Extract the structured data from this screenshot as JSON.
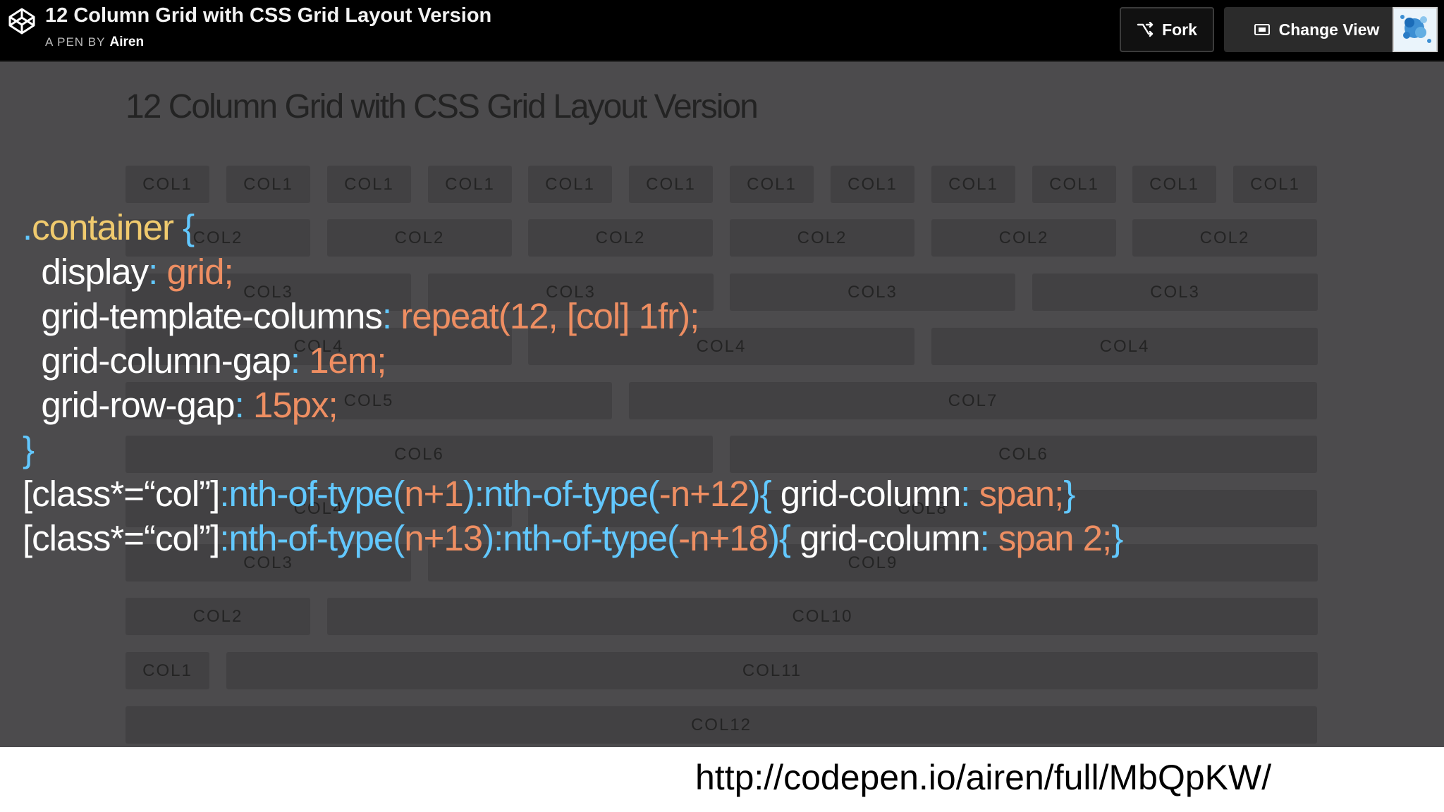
{
  "header": {
    "title": "12 Column Grid with CSS Grid Layout Version",
    "by_label": "A PEN BY",
    "author": "Airen",
    "fork_label": "Fork",
    "change_view_label": "Change View",
    "logo_icon": "codepen-logo-icon",
    "fork_icon": "fork-icon",
    "view_icon": "change-view-icon"
  },
  "main": {
    "heading": "12 Column Grid with CSS Grid Layout Version",
    "rows": [
      {
        "cells": [
          {
            "label": "COL1"
          },
          {
            "label": "COL1"
          },
          {
            "label": "COL1"
          },
          {
            "label": "COL1"
          },
          {
            "label": "COL1"
          },
          {
            "label": "COL1"
          },
          {
            "label": "COL1"
          },
          {
            "label": "COL1"
          },
          {
            "label": "COL1"
          },
          {
            "label": "COL1"
          },
          {
            "label": "COL1"
          },
          {
            "label": "COL1"
          }
        ]
      },
      {
        "cells": [
          {
            "label": "COL2"
          },
          {
            "label": "COL2"
          },
          {
            "label": "COL2"
          },
          {
            "label": "COL2"
          },
          {
            "label": "COL2"
          },
          {
            "label": "COL2"
          }
        ]
      },
      {
        "cells": [
          {
            "label": "COL3"
          },
          {
            "label": "COL3"
          },
          {
            "label": "COL3"
          },
          {
            "label": "COL3"
          }
        ]
      },
      {
        "cells": [
          {
            "label": "COL4"
          },
          {
            "label": "COL4"
          },
          {
            "label": "COL4"
          }
        ]
      },
      {
        "cells": [
          {
            "label": "COL5"
          },
          {
            "label": "COL7"
          }
        ]
      },
      {
        "cells": [
          {
            "label": "COL6"
          },
          {
            "label": "COL6"
          }
        ]
      },
      {
        "cells": [
          {
            "label": "COL4"
          },
          {
            "label": "COL8"
          }
        ]
      },
      {
        "cells": [
          {
            "label": "COL3"
          },
          {
            "label": "COL9"
          }
        ]
      },
      {
        "cells": [
          {
            "label": "COL2"
          },
          {
            "label": "COL10"
          }
        ]
      },
      {
        "cells": [
          {
            "label": "COL1"
          },
          {
            "label": "COL11"
          }
        ]
      },
      {
        "cells": [
          {
            "label": "COL12"
          }
        ]
      }
    ]
  },
  "code": {
    "lines": [
      [
        {
          "t": ".",
          "c": "k-blue"
        },
        {
          "t": "container",
          "c": "k-sel"
        },
        {
          "t": " {",
          "c": "k-blue"
        }
      ],
      [
        {
          "t": "  display",
          "c": "k-white"
        },
        {
          "t": ": ",
          "c": "k-blue"
        },
        {
          "t": "grid;",
          "c": "k-orange"
        }
      ],
      [
        {
          "t": "  grid-template-columns",
          "c": "k-white"
        },
        {
          "t": ": ",
          "c": "k-blue"
        },
        {
          "t": "repeat(12, [col] 1fr);",
          "c": "k-orange"
        }
      ],
      [
        {
          "t": "  grid-column-gap",
          "c": "k-white"
        },
        {
          "t": ": ",
          "c": "k-blue"
        },
        {
          "t": "1em;",
          "c": "k-orange"
        }
      ],
      [
        {
          "t": "  grid-row-gap",
          "c": "k-white"
        },
        {
          "t": ": ",
          "c": "k-blue"
        },
        {
          "t": "15px;",
          "c": "k-orange"
        }
      ],
      [
        {
          "t": "}",
          "c": "k-blue"
        }
      ],
      [
        {
          "t": "[class*=“col”]",
          "c": "k-white"
        },
        {
          "t": ":nth-of-type(",
          "c": "k-blue"
        },
        {
          "t": "n+1",
          "c": "k-orange"
        },
        {
          "t": "):nth-of-type(",
          "c": "k-blue"
        },
        {
          "t": "-n+12",
          "c": "k-orange"
        },
        {
          "t": "){ ",
          "c": "k-blue"
        },
        {
          "t": "grid-column",
          "c": "k-white"
        },
        {
          "t": ": ",
          "c": "k-blue"
        },
        {
          "t": "span;",
          "c": "k-orange"
        },
        {
          "t": "}",
          "c": "k-blue"
        }
      ],
      [
        {
          "t": "[class*=“col”]",
          "c": "k-white"
        },
        {
          "t": ":nth-of-type(",
          "c": "k-blue"
        },
        {
          "t": "n+13",
          "c": "k-orange"
        },
        {
          "t": "):nth-of-type(",
          "c": "k-blue"
        },
        {
          "t": "-n+18",
          "c": "k-orange"
        },
        {
          "t": "){ ",
          "c": "k-blue"
        },
        {
          "t": "grid-column",
          "c": "k-white"
        },
        {
          "t": ": ",
          "c": "k-blue"
        },
        {
          "t": "span 2;",
          "c": "k-orange"
        },
        {
          "t": "}",
          "c": "k-blue"
        }
      ]
    ]
  },
  "footer": {
    "url": "http://codepen.io/airen/full/MbQpKW/"
  },
  "colors": {
    "topbar_bg": "#000000",
    "preview_bg": "#4c4b4d",
    "cell_bg": "#424143",
    "selector": "#f0ca6e",
    "value": "#ee8e62",
    "punctuation": "#62c8ff"
  }
}
